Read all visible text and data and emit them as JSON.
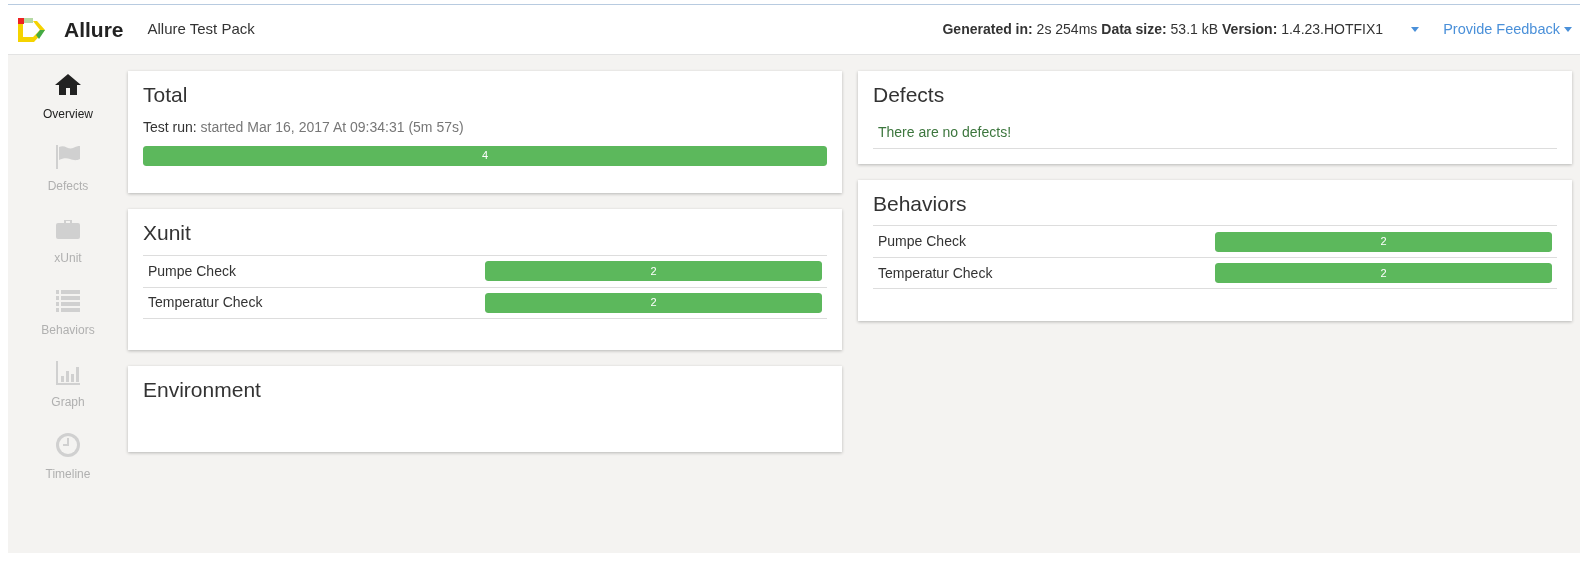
{
  "header": {
    "brand": "Allure",
    "report_title": "Allure Test Pack",
    "info": [
      {
        "label": "Generated in:",
        "value": "2s 254ms"
      },
      {
        "label": "Data size:",
        "value": "53.1 kB"
      },
      {
        "label": "Version:",
        "value": "1.4.23.HOTFIX1"
      }
    ],
    "feedback": "Provide Feedback"
  },
  "sidebar": {
    "items": [
      {
        "kind": "home",
        "label": "Overview",
        "selected": true
      },
      {
        "kind": "flag",
        "label": "Defects",
        "selected": false
      },
      {
        "kind": "briefcase",
        "label": "xUnit",
        "selected": false
      },
      {
        "kind": "list",
        "label": "Behaviors",
        "selected": false
      },
      {
        "kind": "graph",
        "label": "Graph",
        "selected": false
      },
      {
        "kind": "clock",
        "label": "Timeline",
        "selected": false
      }
    ]
  },
  "total": {
    "title": "Total",
    "run_label": "Test run:",
    "run_text": "started Mar 16, 2017 At 09:34:31 (5m 57s)",
    "count": "4",
    "level": 1
  },
  "xunit": {
    "title": "Xunit",
    "rows": [
      {
        "name": "Pumpe Check",
        "count": "2",
        "level": 1
      },
      {
        "name": "Temperatur Check",
        "count": "2",
        "level": 1
      }
    ]
  },
  "environment": {
    "title": "Environment"
  },
  "defects": {
    "title": "Defects",
    "message": "There are no defects!"
  },
  "behaviors": {
    "title": "Behaviors",
    "rows": [
      {
        "name": "Pumpe Check",
        "count": "2",
        "level": 1
      },
      {
        "name": "Temperatur Check",
        "count": "2",
        "level": 1
      }
    ]
  }
}
